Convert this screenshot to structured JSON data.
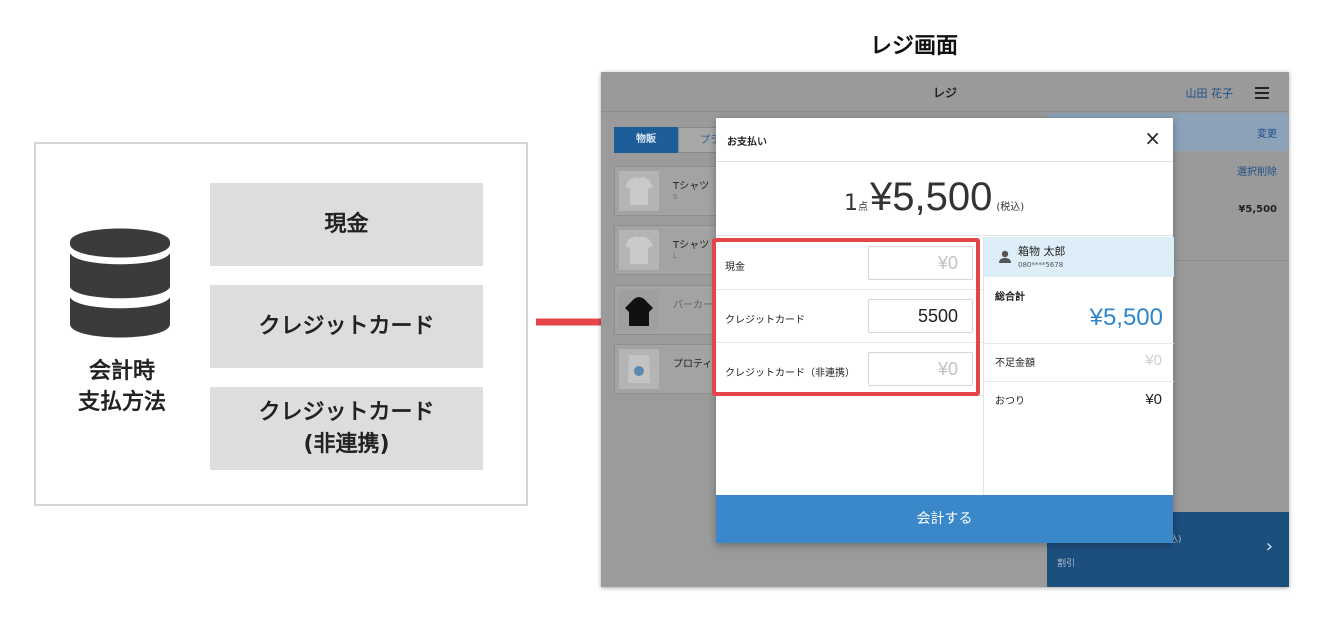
{
  "screen_title": "レジ画面",
  "diagram": {
    "caption_line1": "会計時",
    "caption_line2": "支払方法",
    "methods": [
      {
        "line1": "現金",
        "line2": ""
      },
      {
        "line1": "クレジットカード",
        "line2": ""
      },
      {
        "line1": "クレジットカード",
        "line2": "(非連携)"
      }
    ],
    "icon": "database-icon"
  },
  "app": {
    "header_title": "レジ",
    "user_name": "山田 花子",
    "menu_icon": "hamburger-menu-icon",
    "tabs": [
      {
        "label": "物販",
        "active": true
      },
      {
        "label": "プラ",
        "active": false
      }
    ],
    "products": [
      {
        "name": "Tシャツ",
        "sub": "S",
        "dim": false,
        "thumb": "tshirt"
      },
      {
        "name": "Tシャツ",
        "sub": "L",
        "dim": false,
        "thumb": "tshirt"
      },
      {
        "name": "パーカー",
        "sub": "",
        "dim": true,
        "thumb": "hoodie"
      },
      {
        "name": "プロティ",
        "sub": "",
        "dim": false,
        "thumb": "bag"
      }
    ],
    "right_panel": {
      "change_link": "変更",
      "delete_link": "選択削除",
      "item_price": "¥5,500",
      "bottom_tax": "込)",
      "bottom_discount": "割引",
      "bottom_chevron": "›"
    }
  },
  "modal": {
    "title": "お支払い",
    "close_icon": "close-icon",
    "quantity": "1",
    "quantity_unit": "点",
    "total": "¥5,500",
    "tax_label": "(税込)",
    "payments": [
      {
        "label": "現金",
        "value": "¥0",
        "placeholder": true
      },
      {
        "label": "クレジットカード",
        "value": "5500",
        "placeholder": false
      },
      {
        "label": "クレジットカード（非連携）",
        "value": "¥0",
        "placeholder": true
      }
    ],
    "customer": {
      "name": "箱物 太郎",
      "phone": "080****5678"
    },
    "grand_total_label": "総合計",
    "grand_total_value": "¥5,500",
    "shortage_label": "不足金額",
    "shortage_value": "¥0",
    "change_label": "おつり",
    "change_value": "¥0",
    "checkout_label": "会計する"
  },
  "colors": {
    "highlight": "#e54548",
    "accent": "#3a88ca",
    "grand_total": "#2f86c9"
  }
}
